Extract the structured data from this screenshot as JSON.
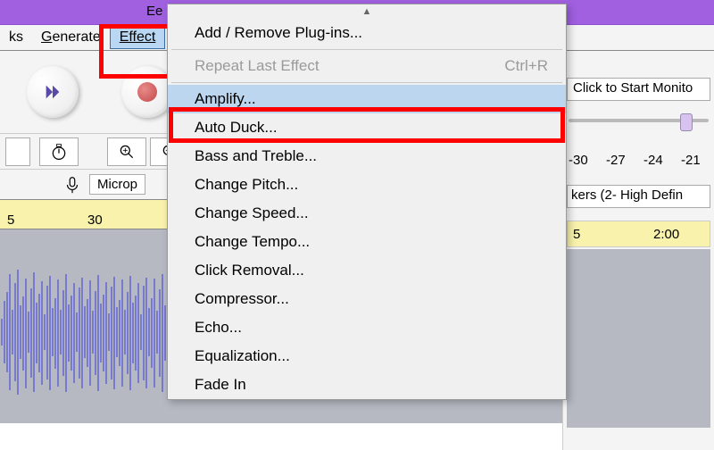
{
  "title": "Ee",
  "menubar": {
    "tracks": "ks",
    "generate": "Generate",
    "effect": "Effect"
  },
  "dropdown": {
    "add_remove": "Add / Remove Plug-ins...",
    "repeat": "Repeat Last Effect",
    "repeat_shortcut": "Ctrl+R",
    "amplify": "Amplify...",
    "auto_duck": "Auto Duck...",
    "bass_treble": "Bass and Treble...",
    "change_pitch": "Change Pitch...",
    "change_speed": "Change Speed...",
    "change_tempo": "Change Tempo...",
    "click_removal": "Click Removal...",
    "compressor": "Compressor...",
    "echo": "Echo...",
    "equalization": "Equalization...",
    "fade_in": "Fade In"
  },
  "devices": {
    "mic": "Microp"
  },
  "timeline": {
    "t1": "5",
    "t2": "30"
  },
  "right": {
    "click_monitor": "Click to Start Monito",
    "db_m30": "-30",
    "db_m27": "-27",
    "db_m24": "-24",
    "db_m21": "-21",
    "speakers": "kers (2- High Defin",
    "ruler_t1": "5",
    "ruler_t2": "2:00"
  }
}
